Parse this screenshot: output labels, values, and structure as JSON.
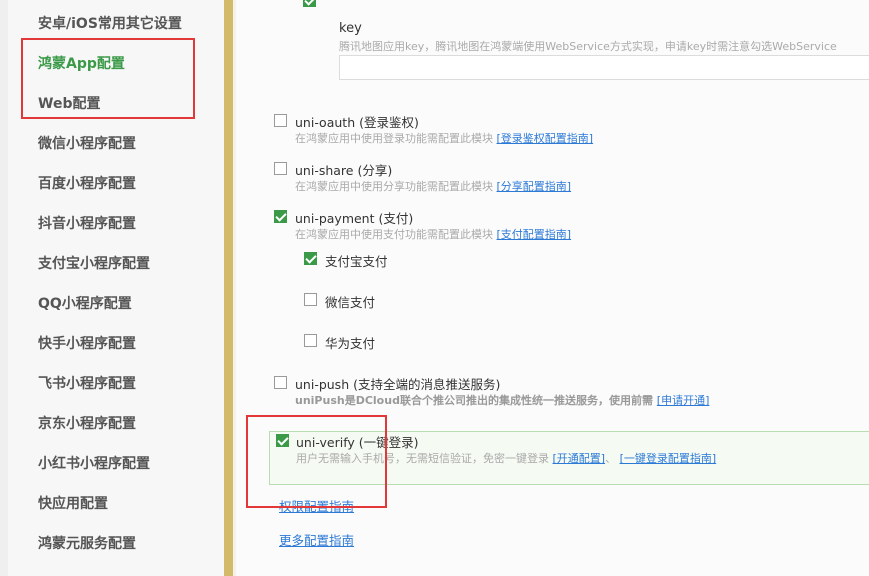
{
  "sidebar": {
    "items": [
      {
        "label": "安卓/iOS常用其它设置",
        "active": false
      },
      {
        "label": "鸿蒙App配置",
        "active": true
      },
      {
        "label": "Web配置",
        "active": false
      },
      {
        "label": "微信小程序配置",
        "active": false
      },
      {
        "label": "百度小程序配置",
        "active": false
      },
      {
        "label": "抖音小程序配置",
        "active": false
      },
      {
        "label": "支付宝小程序配置",
        "active": false
      },
      {
        "label": "QQ小程序配置",
        "active": false
      },
      {
        "label": "快手小程序配置",
        "active": false
      },
      {
        "label": "飞书小程序配置",
        "active": false
      },
      {
        "label": "京东小程序配置",
        "active": false
      },
      {
        "label": "小红书小程序配置",
        "active": false
      },
      {
        "label": "快应用配置",
        "active": false
      },
      {
        "label": "鸿蒙元服务配置",
        "active": false
      }
    ]
  },
  "map_key": {
    "label": "key",
    "description": "腾讯地图应用key，腾讯地图在鸿蒙端使用WebService方式实现，申请key时需注意勾选WebService",
    "value": ""
  },
  "modules": {
    "oauth": {
      "title": "uni-oauth (登录鉴权)",
      "desc": "在鸿蒙应用中使用登录功能需配置此模块",
      "link": "[登录鉴权配置指南]",
      "checked": false
    },
    "share": {
      "title": "uni-share (分享)",
      "desc": "在鸿蒙应用中使用分享功能需配置此模块",
      "link": "[分享配置指南]",
      "checked": false
    },
    "payment": {
      "title": "uni-payment (支付)",
      "desc": "在鸿蒙应用中使用支付功能需配置此模块",
      "link": "[支付配置指南]",
      "checked": true,
      "options": [
        {
          "label": "支付宝支付",
          "checked": true
        },
        {
          "label": "微信支付",
          "checked": false
        },
        {
          "label": "华为支付",
          "checked": false
        }
      ]
    },
    "push": {
      "title": "uni-push (支持全端的消息推送服务)",
      "desc": "uniPush是DCloud联合个推公司推出的集成性统一推送服务，使用前需",
      "link": "[申请开通]",
      "checked": false
    },
    "verify": {
      "title": "uni-verify (一键登录)",
      "desc": "用户无需输入手机号，无需短信验证，免密一键登录",
      "link1": "[开通配置]",
      "separator": "、",
      "link2": "[一键登录配置指南]",
      "checked": true
    }
  },
  "footer_links": {
    "permissions": "权限配置指南",
    "more": "更多配置指南"
  },
  "colors": {
    "accent_green": "#3a9a48",
    "highlight_red": "#e3383a",
    "link_blue": "#2d7ad6",
    "scrollbar": "#d3ba6a"
  }
}
